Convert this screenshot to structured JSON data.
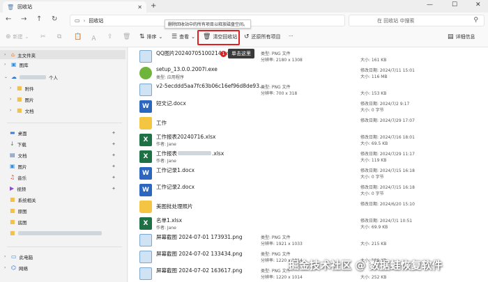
{
  "window": {
    "tab_title": "回收站",
    "new_tab_icon": "plus",
    "minimize_icon": "minimize",
    "maximize_icon": "maximize",
    "close_icon": "close"
  },
  "address": {
    "path": "回收站",
    "search_placeholder": "在 回收站 中搜索"
  },
  "tooltip": "删除回收站中的所有项目以释放磁盘空间。",
  "toolbar": {
    "new_label": "新建",
    "sort_label": "排序",
    "view_label": "查看",
    "empty_recycle_bin_label": "清空回收站",
    "restore_all_label": "还原所有项目",
    "more_label": "···",
    "details_label": "详细信息",
    "accent_color": "#e02020"
  },
  "callout": {
    "number": "1",
    "label": "单击这里"
  },
  "sidebar": {
    "items": [
      {
        "label": "主文件夹",
        "icon": "home-icon"
      },
      {
        "label": "图库",
        "icon": "gallery-icon"
      },
      {
        "label": "个人",
        "icon": "cloud-icon"
      },
      {
        "label": "附件",
        "icon": "folder-icon"
      },
      {
        "label": "图片",
        "icon": "folder-icon"
      },
      {
        "label": "文档",
        "icon": "folder-icon"
      },
      {
        "label": "桌面",
        "icon": "desktop-icon"
      },
      {
        "label": "下载",
        "icon": "download-icon"
      },
      {
        "label": "文档",
        "icon": "document-icon"
      },
      {
        "label": "图片",
        "icon": "picture-icon"
      },
      {
        "label": "音乐",
        "icon": "music-icon"
      },
      {
        "label": "视频",
        "icon": "video-icon"
      },
      {
        "label": "系统相关",
        "icon": "folder-icon"
      },
      {
        "label": "原图",
        "icon": "folder-icon"
      },
      {
        "label": "底图",
        "icon": "folder-icon"
      },
      {
        "label": "此电脑",
        "icon": "pc-icon"
      },
      {
        "label": "网络",
        "icon": "network-icon"
      }
    ]
  },
  "files": [
    {
      "name": "QQ图片20240705100214.png",
      "type": "img",
      "meta1": "类型: PNG 文件",
      "meta2": "分辨率: 2180 x 1308",
      "right1": "大小: 161 KB",
      "right2": ""
    },
    {
      "name": "setup_13.0.0.2007l.exe",
      "sub": "类型: 应用程序",
      "type": "exe",
      "meta1": "",
      "meta2": "",
      "right1": "修改日期: 2024/7/11 15:01",
      "right2": "大小: 116 MB"
    },
    {
      "name": "v2-5ecddd5aa7fc63b06c16ef96d8de93...",
      "type": "img",
      "meta1": "类型: PNG 文件",
      "meta2": "分辨率: 700 x 318",
      "right1": "大小: 153 KB",
      "right2": ""
    },
    {
      "name": "短文记.docx",
      "type": "doc",
      "meta1": "",
      "meta2": "",
      "right1": "修改日期: 2024/7/2 9:17",
      "right2": "大小: 0 字节"
    },
    {
      "name": "工作",
      "type": "folder",
      "meta1": "",
      "meta2": "",
      "right1": "修改日期: 2024/7/29 17:07",
      "right2": ""
    },
    {
      "name": "工作报表20240716.xlsx",
      "sub": "作者: Jane",
      "type": "xls",
      "meta1": "",
      "meta2": "",
      "right1": "修改日期: 2024/7/16 18:01",
      "right2": "大小: 69.5 KB"
    },
    {
      "name": "工作报表",
      "name_suffix": ".xlsx",
      "sub": "作者: Jane",
      "type": "xls",
      "meta1": "",
      "meta2": "",
      "right1": "修改日期: 2024/7/29 11:17",
      "right2": "大小: 119 KB"
    },
    {
      "name": "工作记录1.docx",
      "type": "doc",
      "meta1": "",
      "meta2": "",
      "right1": "修改日期: 2024/7/15 16:18",
      "right2": "大小: 0 字节"
    },
    {
      "name": "工作记录2.docx",
      "type": "doc",
      "meta1": "",
      "meta2": "",
      "right1": "修改日期: 2024/7/15 16:18",
      "right2": "大小: 0 字节"
    },
    {
      "name": "美图批处理照片",
      "type": "folder",
      "meta1": "",
      "meta2": "",
      "right1": "修改日期: 2024/6/20 15:10",
      "right2": ""
    },
    {
      "name": "名单1.xlsx",
      "sub": "作者: Jane",
      "type": "xls",
      "meta1": "",
      "meta2": "",
      "right1": "修改日期: 2024/7/1 10:51",
      "right2": "大小: 69.9 KB"
    },
    {
      "name": "屏幕截图 2024-07-01 173931.png",
      "type": "img",
      "meta1": "类型: PNG 文件",
      "meta2": "分辨率: 1921 x 1033",
      "right1": "大小: 215 KB",
      "right2": ""
    },
    {
      "name": "屏幕截图 2024-07-02 133434.png",
      "type": "img",
      "meta1": "类型: PNG 文件",
      "meta2": "分辨率: 1220 x 1014",
      "right1": "大小: 189 KB",
      "right2": ""
    },
    {
      "name": "屏幕截图 2024-07-02 163617.png",
      "type": "img",
      "meta1": "类型: PNG 文件",
      "meta2": "分辨率: 1220 x 1014",
      "right1": "大小: 252 KB",
      "right2": ""
    }
  ],
  "watermark": "掘金技术社区 @ 数据蛙恢复软件"
}
